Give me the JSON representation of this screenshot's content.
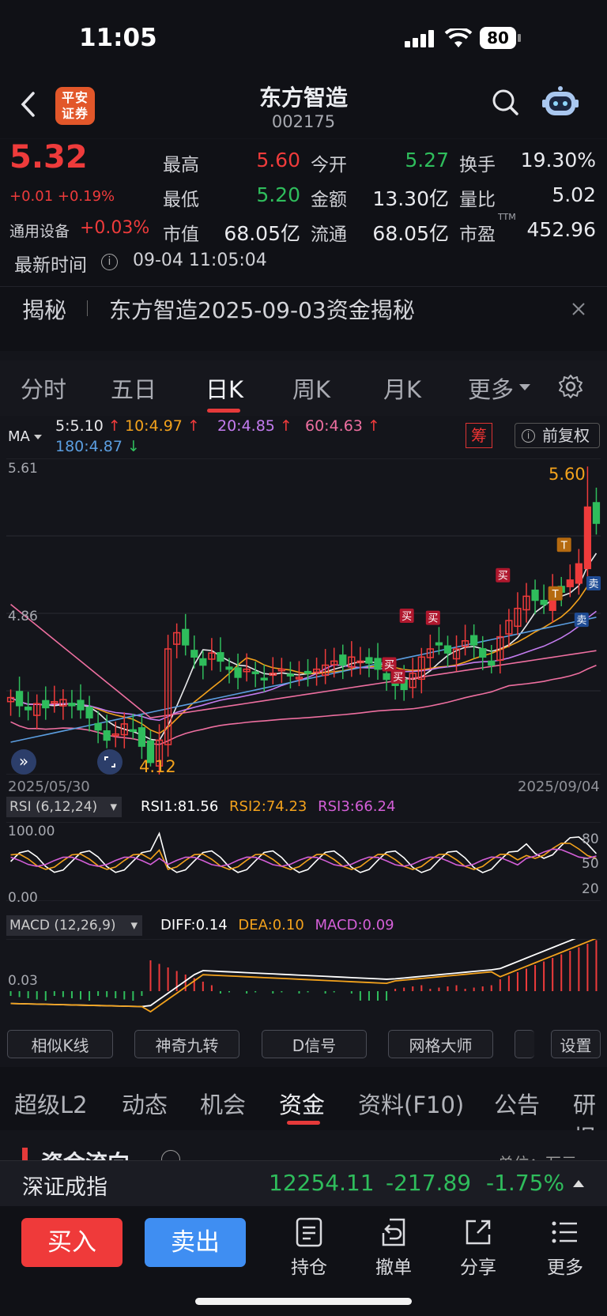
{
  "status": {
    "time": "11:05",
    "battery": "80"
  },
  "header": {
    "name": "东方智造",
    "code": "002175",
    "broker_logo": "平安证券"
  },
  "quote": {
    "price": "5.32",
    "change": "+0.01 +0.19%",
    "sector": "通用设备",
    "sector_change": "+0.03%",
    "grid": [
      {
        "label": "最高",
        "value": "5.60",
        "tone": "red"
      },
      {
        "label": "今开",
        "value": "5.27",
        "tone": "green"
      },
      {
        "label": "换手",
        "value": "19.30%",
        "tone": "white"
      },
      {
        "label": "最低",
        "value": "5.20",
        "tone": "green"
      },
      {
        "label": "金额",
        "value": "13.30亿",
        "tone": "white"
      },
      {
        "label": "量比",
        "value": "5.02",
        "tone": "white"
      },
      {
        "label": "市值",
        "value": "68.05亿",
        "tone": "white"
      },
      {
        "label": "流通",
        "value": "68.05亿",
        "tone": "white"
      },
      {
        "label": "市盈",
        "value": "452.96",
        "tone": "white",
        "sup": "TTM"
      }
    ],
    "time_label": "最新时间",
    "time_value": "09-04 11:05:04",
    "reveal_tag": "揭秘",
    "reveal_text": "东方智造2025-09-03资金揭秘"
  },
  "ktabs": [
    "分时",
    "五日",
    "日K",
    "周K",
    "月K",
    "更多"
  ],
  "active_ktab": "日K",
  "ma": {
    "label": "MA",
    "items": [
      {
        "text": "5:5.10",
        "arrow": "↑",
        "color": "#e8e8ea"
      },
      {
        "text": "10:4.97",
        "arrow": "↑",
        "color": "#f3a21c"
      },
      {
        "text": "20:4.85",
        "arrow": "↑",
        "color": "#c47cf0"
      },
      {
        "text": "60:4.63",
        "arrow": "↑",
        "color": "#ee6fa0"
      },
      {
        "text": "180:4.87",
        "arrow": "↓",
        "color": "#5b9ee0"
      }
    ],
    "chip": "筹",
    "fq": "前复权"
  },
  "chart_data": [
    {
      "type": "candlestick",
      "y_ticks": [
        "5.61",
        "4.86",
        "4.12"
      ],
      "high_label": "5.60",
      "low_label": "4.12",
      "start_date": "2025/05/30",
      "end_date": "2025/09/04",
      "signals": [
        "买",
        "买",
        "买",
        "买",
        "买",
        "T",
        "T",
        "卖",
        "卖"
      ]
    },
    {
      "type": "line",
      "name": "RSI (6,12,24)",
      "series": [
        {
          "name": "RSI1",
          "value": "81.56",
          "color": "#ffffff"
        },
        {
          "name": "RSI2",
          "value": "74.23",
          "color": "#f3a21c"
        },
        {
          "name": "RSI3",
          "value": "66.24",
          "color": "#d45fd8"
        }
      ],
      "y_ticks_left": [
        "100.00",
        "0.00"
      ],
      "y_ticks_right": [
        "80",
        "50",
        "20"
      ]
    },
    {
      "type": "bar",
      "name": "MACD (12,26,9)",
      "series": [
        {
          "name": "DIFF",
          "value": "0.14",
          "color": "#ffffff"
        },
        {
          "name": "DEA",
          "value": "0.10",
          "color": "#f3a21c"
        },
        {
          "name": "MACD",
          "value": "0.09",
          "color": "#d45fd8"
        }
      ],
      "y_ticks_left": [
        "0.03"
      ]
    }
  ],
  "tools": [
    "相似K线",
    "神奇九转",
    "D信号",
    "网格大师",
    "设置"
  ],
  "info_tabs": [
    "超级L2",
    "动态",
    "机会",
    "资金",
    "资料(F10)",
    "公告",
    "研报"
  ],
  "active_info_tab": "资金",
  "section": {
    "title": "资金流向",
    "unit": "单位：万元"
  },
  "index": {
    "name": "深证成指",
    "value": "12254.11",
    "change": "-217.89",
    "pct": "-1.75%"
  },
  "bottom": {
    "buy": "买入",
    "sell": "卖出",
    "actions": [
      "持仓",
      "撤单",
      "分享",
      "更多"
    ]
  }
}
